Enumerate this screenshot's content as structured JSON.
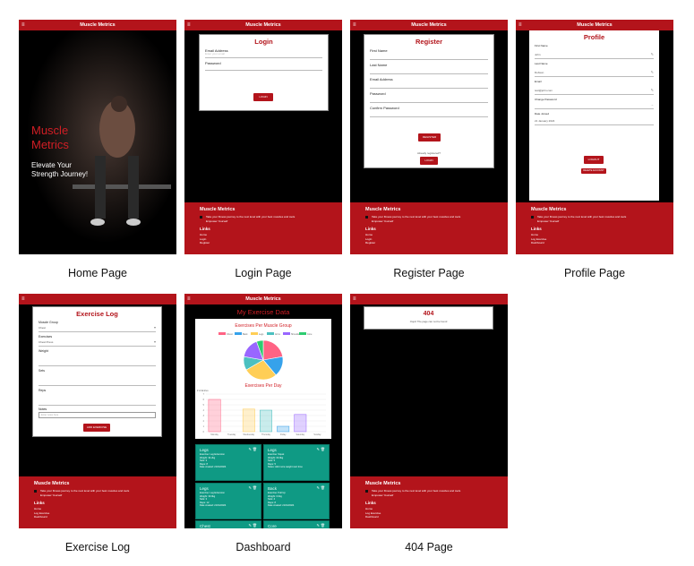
{
  "app": {
    "name": "Muscle Metrics",
    "menu_icon": "≡",
    "hero_title": "Muscle Metrics",
    "hero_subtitle": "Elevate Your Strength Journey!"
  },
  "footer": {
    "title": "Muscle Metrics",
    "tagline": "Take your fitness journey to the next level with your best muscles and tools",
    "subtext": "Empower Yourself",
    "links_heading": "Links",
    "links_public": [
      "Home",
      "Login",
      "Register"
    ],
    "links_private": [
      "Home",
      "Log Exercise",
      "Dashboard"
    ]
  },
  "captions": {
    "home": "Home Page",
    "login": "Login Page",
    "register": "Register Page",
    "profile": "Profile Page",
    "exercise": "Exercise Log",
    "dashboard": "Dashboard",
    "notfound": "404 Page"
  },
  "login": {
    "title": "Login",
    "email_label": "Email Address",
    "email_hint": "Enter your email",
    "password_label": "Password",
    "button": "LOGIN"
  },
  "register": {
    "title": "Register",
    "first_name": "First Name",
    "last_name": "Last Name",
    "email": "Email Address",
    "password": "Password",
    "confirm": "Confirm Password",
    "button": "REGISTER",
    "already": "Already registered?",
    "login_button": "LOGIN"
  },
  "profile": {
    "title": "Profile",
    "first_name_label": "First Name",
    "first_name": "John",
    "last_name_label": "Last Name",
    "last_name": "Dobson",
    "email_label": "Email",
    "email": "test@john.com",
    "change_password": "Change Password",
    "date_joined_label": "Date Joined",
    "date_joined": "21 January 2024",
    "logout_button": "LOGOUT",
    "delete_button": "DELETE ACCOUNT"
  },
  "exercise_log": {
    "title": "Exercise Log",
    "muscle_group_label": "Muscle Group",
    "muscle_group_value": "Chest",
    "exercise_label": "Exercises",
    "exercise_value": "Chest Press",
    "weight_label": "Weight",
    "sets_label": "Sets",
    "reps_label": "Reps",
    "notes_label": "Notes",
    "notes_placeholder": "Enter notes here",
    "button": "ADD EXERCISE"
  },
  "dashboard": {
    "title": "My Exercise Data",
    "entries": [
      {
        "group": "Legs",
        "exercise": "Exercise: Leg Extension",
        "weight": "Weight: 34.2kg",
        "sets": "Sets: 3",
        "reps": "Reps: 8",
        "date": "Date created: 21/01/2024"
      },
      {
        "group": "Legs",
        "exercise": "Exercise: Squat",
        "weight": "Weight: 60.0kg",
        "sets": "Sets: 5",
        "reps": "Reps: 5",
        "date": "Notes: Add more weight next time"
      },
      {
        "group": "Legs",
        "exercise": "Exercise: Leg Extension",
        "weight": "Weight: 30.0kg",
        "sets": "Sets: 3",
        "reps": "Reps: 12",
        "date": "Date created: 21/01/2024"
      },
      {
        "group": "Back",
        "exercise": "Exercise: Pull Up",
        "weight": "Weight: 0.0kg",
        "sets": "Sets: 4",
        "reps": "Reps: 8",
        "date": "Date created: 21/01/2024"
      },
      {
        "group": "Chest",
        "exercise": "",
        "weight": "",
        "sets": "",
        "reps": "",
        "date": ""
      },
      {
        "group": "Core",
        "exercise": "",
        "weight": "",
        "sets": "",
        "reps": "",
        "date": ""
      }
    ]
  },
  "notfound": {
    "code": "404",
    "message": "Oops! The page can not be found"
  },
  "chart_data": [
    {
      "type": "pie",
      "title": "Exercises Per Muscle Group",
      "categories": [
        "Chest",
        "Back",
        "Legs",
        "Arms",
        "Shoulders",
        "Core"
      ],
      "values": [
        4,
        3,
        5,
        2,
        3,
        1
      ],
      "colors": [
        "#ff6384",
        "#36a2eb",
        "#ffce56",
        "#4bc0c0",
        "#9966ff",
        "#2ecc71"
      ],
      "legend": "top"
    },
    {
      "type": "bar",
      "title": "Exercises Per Day",
      "categories": [
        "Monday",
        "Tuesday",
        "Wednesday",
        "Thursday",
        "Friday",
        "Saturday",
        "Sunday"
      ],
      "values": [
        6,
        0,
        4.2,
        4,
        1,
        3.2,
        0
      ],
      "colors": [
        "#ff6384",
        "#ff9f40",
        "#ffce56",
        "#4bc0c0",
        "#36a2eb",
        "#9966ff",
        "#c9cbcf"
      ],
      "ylim": [
        0,
        7
      ],
      "yticks": [
        0,
        1,
        2,
        3,
        4,
        5,
        6,
        7
      ],
      "legend_label": "# of Entries"
    }
  ]
}
